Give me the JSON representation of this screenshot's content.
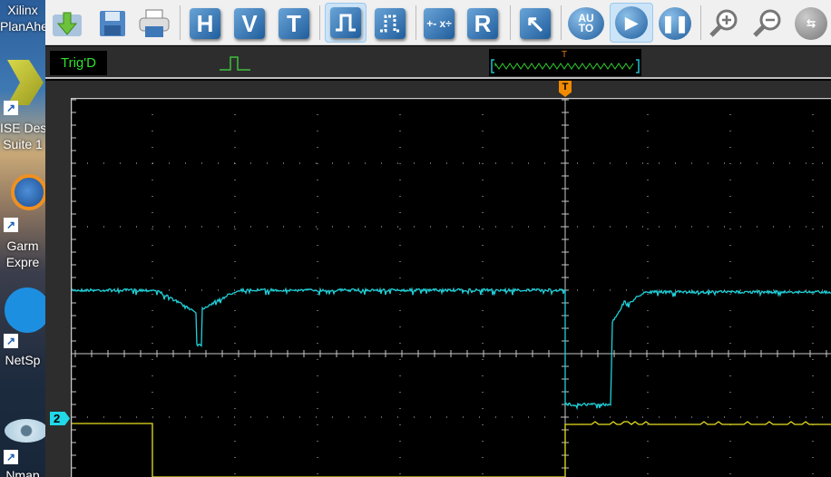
{
  "desktop": {
    "icons": [
      {
        "label": "Xilinx PlanAhead",
        "lines": [
          "Xilinx",
          "PlanAhe"
        ]
      },
      {
        "label": "ISE Design Suite",
        "lines": [
          "ISE Des",
          "Suite 1"
        ]
      },
      {
        "label": "Garmin Express",
        "lines": [
          "Garm",
          "Expre"
        ]
      },
      {
        "label": "NetSpot",
        "lines": [
          "NetSp"
        ]
      },
      {
        "label": "Nmap",
        "lines": [
          "Nmap"
        ]
      }
    ]
  },
  "toolbar": {
    "open": "open-icon",
    "save": "save-icon",
    "print": "print-icon",
    "h": "H",
    "v": "V",
    "t": "T",
    "r": "R",
    "auto": "AU TO",
    "math": "+- x÷"
  },
  "status": {
    "trigger_state": "Trig'D",
    "trigger_marker": "T"
  },
  "scope": {
    "channel2_label": "2",
    "colors": {
      "ch1": "#20d0d8",
      "ch2": "#e8e020",
      "grid": "#c8c8c8",
      "trigger": "#f08a00"
    }
  }
}
